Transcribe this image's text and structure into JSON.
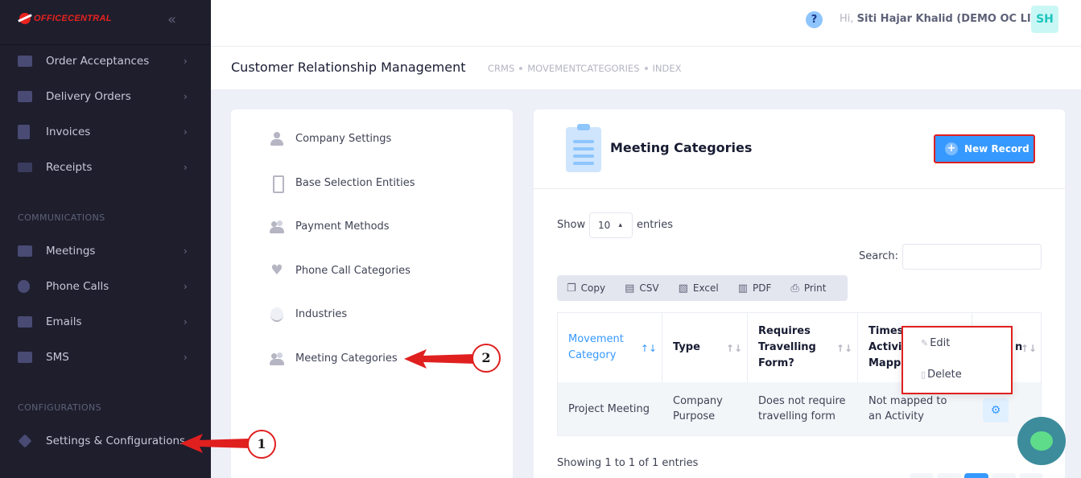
{
  "app": {
    "logo_text": "OFFICECENTRAL",
    "collapse_icon": "double-chevron-left-icon"
  },
  "sidebar": {
    "items": [
      {
        "label": "Order Acceptances",
        "icon": "document-icon"
      },
      {
        "label": "Delivery Orders",
        "icon": "truck-icon"
      },
      {
        "label": "Invoices",
        "icon": "clipboard-icon"
      },
      {
        "label": "Receipts",
        "icon": "receipt-icon"
      },
      {
        "label": "Meetings",
        "icon": "chat-icon"
      },
      {
        "label": "Phone Calls",
        "icon": "phone-icon"
      },
      {
        "label": "Emails",
        "icon": "mail-icon"
      },
      {
        "label": "SMS",
        "icon": "sms-icon"
      },
      {
        "label": "Settings & Configurations",
        "icon": "diamond-icon"
      }
    ],
    "sections": {
      "communications": "COMMUNICATIONS",
      "configurations": "CONFIGURATIONS"
    }
  },
  "header": {
    "help": "?",
    "greeting": "Hi,",
    "user_name": "Siti Hajar Khalid (DEMO OC LITE)",
    "avatar_initials": "SH"
  },
  "subheader": {
    "title": "Customer Relationship Management",
    "breadcrumbs": [
      "CRMS",
      "MOVEMENTCATEGORIES",
      "INDEX"
    ]
  },
  "settings_menu": {
    "items": [
      {
        "label": "Company Settings",
        "icon": "person-icon"
      },
      {
        "label": "Base Selection Entities",
        "icon": "phone-device-icon"
      },
      {
        "label": "Payment Methods",
        "icon": "group-icon"
      },
      {
        "label": "Phone Call Categories",
        "icon": "heart-icon"
      },
      {
        "label": "Industries",
        "icon": "smile-icon"
      },
      {
        "label": "Meeting Categories",
        "icon": "group-icon"
      }
    ]
  },
  "main": {
    "title": "Meeting Categories",
    "new_record_label": "New Record",
    "show_label": "Show",
    "page_length": "10",
    "entries_label": "entries",
    "search_label": "Search:",
    "search_value": "",
    "export_buttons": [
      {
        "label": "Copy",
        "icon": "copy-icon"
      },
      {
        "label": "CSV",
        "icon": "csv-file-icon"
      },
      {
        "label": "Excel",
        "icon": "excel-file-icon"
      },
      {
        "label": "PDF",
        "icon": "pdf-file-icon"
      },
      {
        "label": "Print",
        "icon": "printer-icon"
      }
    ],
    "columns": [
      "Movement Category",
      "Type",
      "Requires Travelling Form?",
      "Timesheet Activity Mapping",
      "Action"
    ],
    "columns_visible": [
      "Movement Category",
      "Type",
      "Requires Travelling Form?",
      "Timesl Activiti Mappi",
      "n"
    ],
    "rows": [
      {
        "category": "Project Meeting",
        "type": "Company Purpose",
        "travel": "Does not require travelling form",
        "mapping": "Not mapped to an Activity"
      }
    ],
    "info": "Showing 1 to 1 of 1 entries",
    "action_menu": {
      "edit": "Edit",
      "delete": "Delete"
    }
  },
  "annotations": {
    "step1": "1",
    "step2": "2",
    "color": "#e01f1f"
  }
}
